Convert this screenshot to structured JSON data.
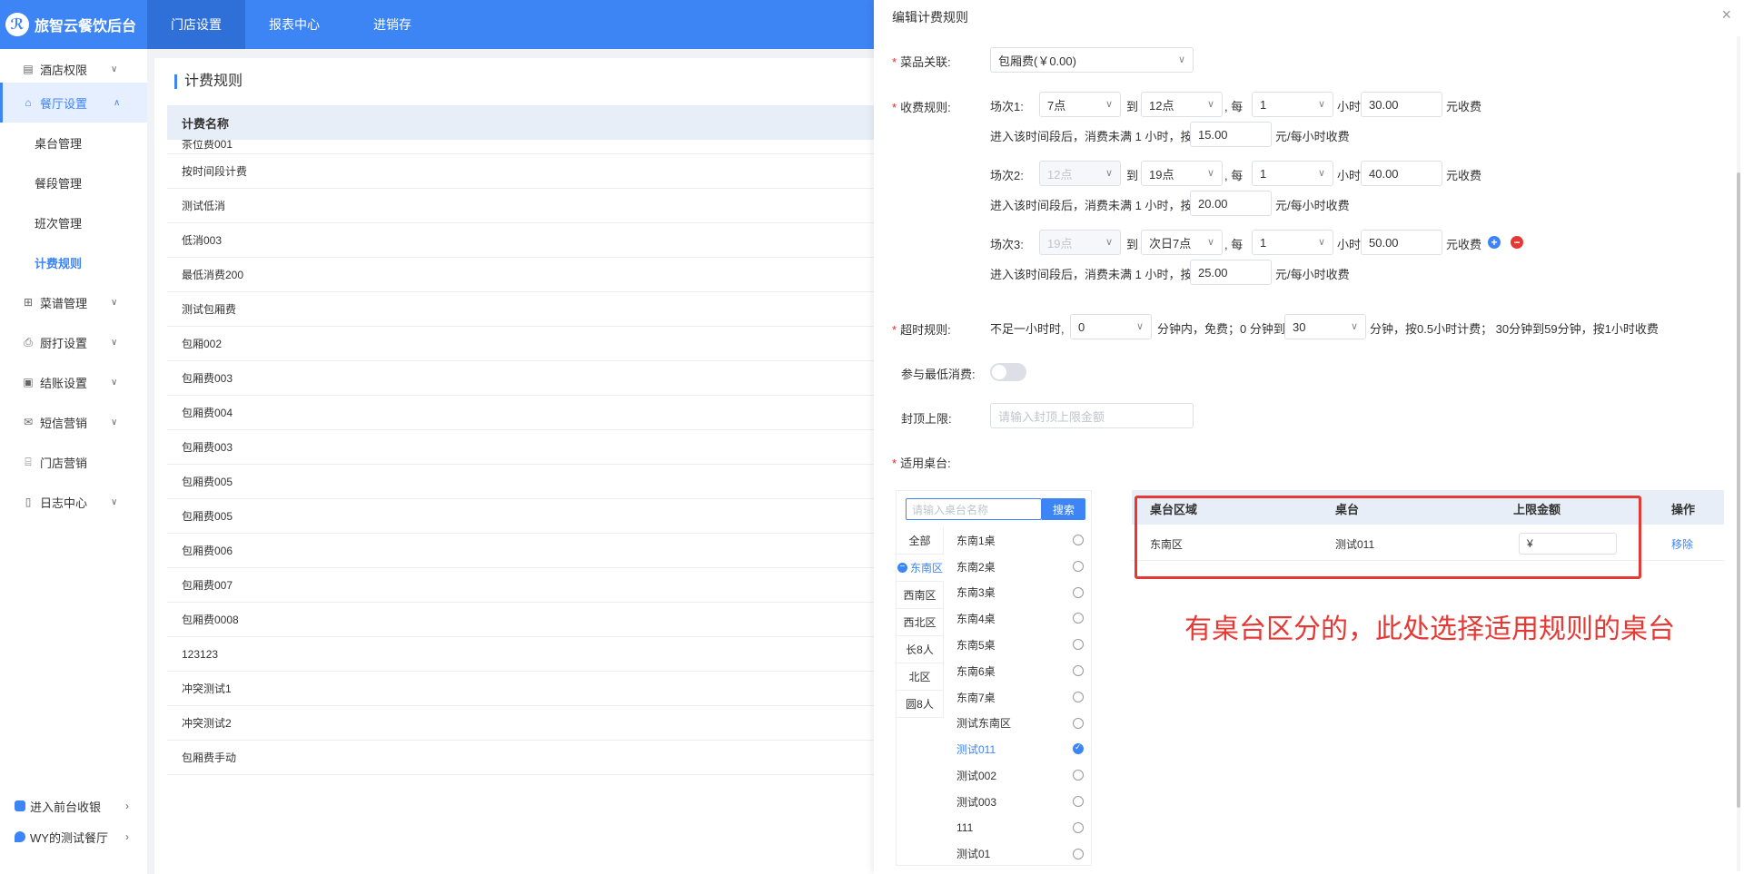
{
  "topbar": {
    "brand": "旅智云餐饮后台",
    "nav": [
      "门店设置",
      "报表中心",
      "进销存"
    ]
  },
  "sidebar": {
    "menu": [
      {
        "label": "酒店权限",
        "icon": "building-icon"
      },
      {
        "label": "餐厅设置",
        "icon": "home-icon"
      },
      {
        "label": "菜谱管理",
        "icon": "grid-icon"
      },
      {
        "label": "厨打设置",
        "icon": "printer-icon"
      },
      {
        "label": "结账设置",
        "icon": "wallet-icon"
      },
      {
        "label": "短信营销",
        "icon": "mail-icon"
      },
      {
        "label": "门店营销",
        "icon": "store-icon"
      },
      {
        "label": "日志中心",
        "icon": "document-icon"
      }
    ],
    "submenu": [
      "桌台管理",
      "餐段管理",
      "班次管理",
      "计费规则"
    ],
    "bottom": [
      "进入前台收银",
      "WY的测试餐厅"
    ]
  },
  "list": {
    "title": "计费规则",
    "column": "计费名称",
    "rows": [
      "茶位费001",
      "按时间段计费",
      "测试低消",
      "低消003",
      "最低消费200",
      "测试包厢费",
      "包厢002",
      "包厢费003",
      "包厢费004",
      "包厢费003",
      "包厢费005",
      "包厢费005",
      "包厢费006",
      "包厢费007",
      "包厢费0008",
      "123123",
      "冲突测试1",
      "冲突测试2",
      "包厢费手动"
    ]
  },
  "drawer": {
    "title": "编辑计费规则",
    "close": "×",
    "labels": {
      "dish": "菜品关联:",
      "charge": "收费规则:",
      "overtime": "超时规则:",
      "min_consume": "参与最低消费:",
      "cap": "封顶上限:",
      "tables": "适用桌台:"
    },
    "dish_value": "包厢费(￥0.00)",
    "sessions": [
      {
        "label": "场次1:",
        "start": "7点",
        "end": "12点",
        "every": "1",
        "price": "30.00",
        "partial": "15.00",
        "start_disabled": false
      },
      {
        "label": "场次2:",
        "start": "12点",
        "end": "19点",
        "every": "1",
        "price": "40.00",
        "partial": "20.00",
        "start_disabled": true
      },
      {
        "label": "场次3:",
        "start": "19点",
        "end": "次日7点",
        "every": "1",
        "price": "50.00",
        "partial": "25.00",
        "start_disabled": true
      }
    ],
    "text": {
      "to": "到",
      "every": ", 每",
      "hour": "小时",
      "charge": "元收费",
      "partial_prefix": "进入该时间段后，消费未满 1 小时，按",
      "partial_suffix": "元/每小时收费"
    },
    "overtime": {
      "prefix": "不足一小时时,",
      "value1": "0",
      "mid": "分钟内，免费；0 分钟到",
      "value2": "30",
      "suffix": "分钟，按0.5小时计费；  30分钟到59分钟，按1小时收费"
    },
    "cap_placeholder": "请输入封顶上限金额",
    "picker": {
      "search_placeholder": "请输入桌台名称",
      "search_btn": "搜索",
      "areas": [
        "全部",
        "东南区",
        "西南区",
        "西北区",
        "长8人",
        "北区",
        "圆8人"
      ],
      "seats": [
        "东南1桌",
        "东南2桌",
        "东南3桌",
        "东南4桌",
        "东南5桌",
        "东南6桌",
        "东南7桌",
        "测试东南区",
        "测试011",
        "测试002",
        "测试003",
        "111",
        "测试01"
      ]
    },
    "selected": {
      "headers": [
        "桌台区域",
        "桌台",
        "上限金额",
        "操作"
      ],
      "row": {
        "area": "东南区",
        "table": "测试011",
        "limit": "¥",
        "action": "移除"
      }
    },
    "annotation": "有桌台区分的，此处选择适用规则的桌台"
  },
  "colors": {
    "primary": "#3d84f5",
    "annotation": "#e53935"
  }
}
